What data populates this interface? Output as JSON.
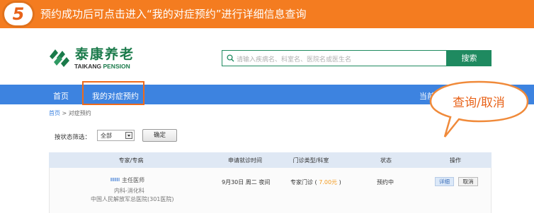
{
  "step": {
    "number": "5",
    "instruction": "预约成功后可点击进入“我的对症预约”进行详细信息查询"
  },
  "logo": {
    "name_cn": "泰康养老",
    "name_en_part1": "TAIKANG",
    "name_en_part2": "PENSION",
    "brand_color": "#1a7a4a"
  },
  "search": {
    "placeholder": "请输入疾病名、科室名、医院名或医生名",
    "button_label": "搜索"
  },
  "nav": {
    "home": "首页",
    "my_appointments": "我的对症预约",
    "right_truncated": "当前"
  },
  "breadcrumb": {
    "home": "首页",
    "separator": ">",
    "current": "对症预约"
  },
  "filter": {
    "label": "按状态筛选：",
    "selected": "全部",
    "confirm_label": "确定"
  },
  "table": {
    "columns": [
      "专家/专病",
      "申请就诊时间",
      "门诊类型/科室",
      "状态",
      "操作"
    ],
    "rows": [
      {
        "doctor_title": "主任医师",
        "department": "内科-消化科",
        "hospital": "中国人民解放军总医院(301医院)",
        "time": "9月30日 周二 夜间",
        "clinic_type": "专家门诊",
        "fee": "7.00元",
        "status": "预约中",
        "detail_label": "详细",
        "cancel_label": "取消"
      }
    ]
  },
  "callout": {
    "text": "查询/取消",
    "accent_color": "#e8631a"
  }
}
